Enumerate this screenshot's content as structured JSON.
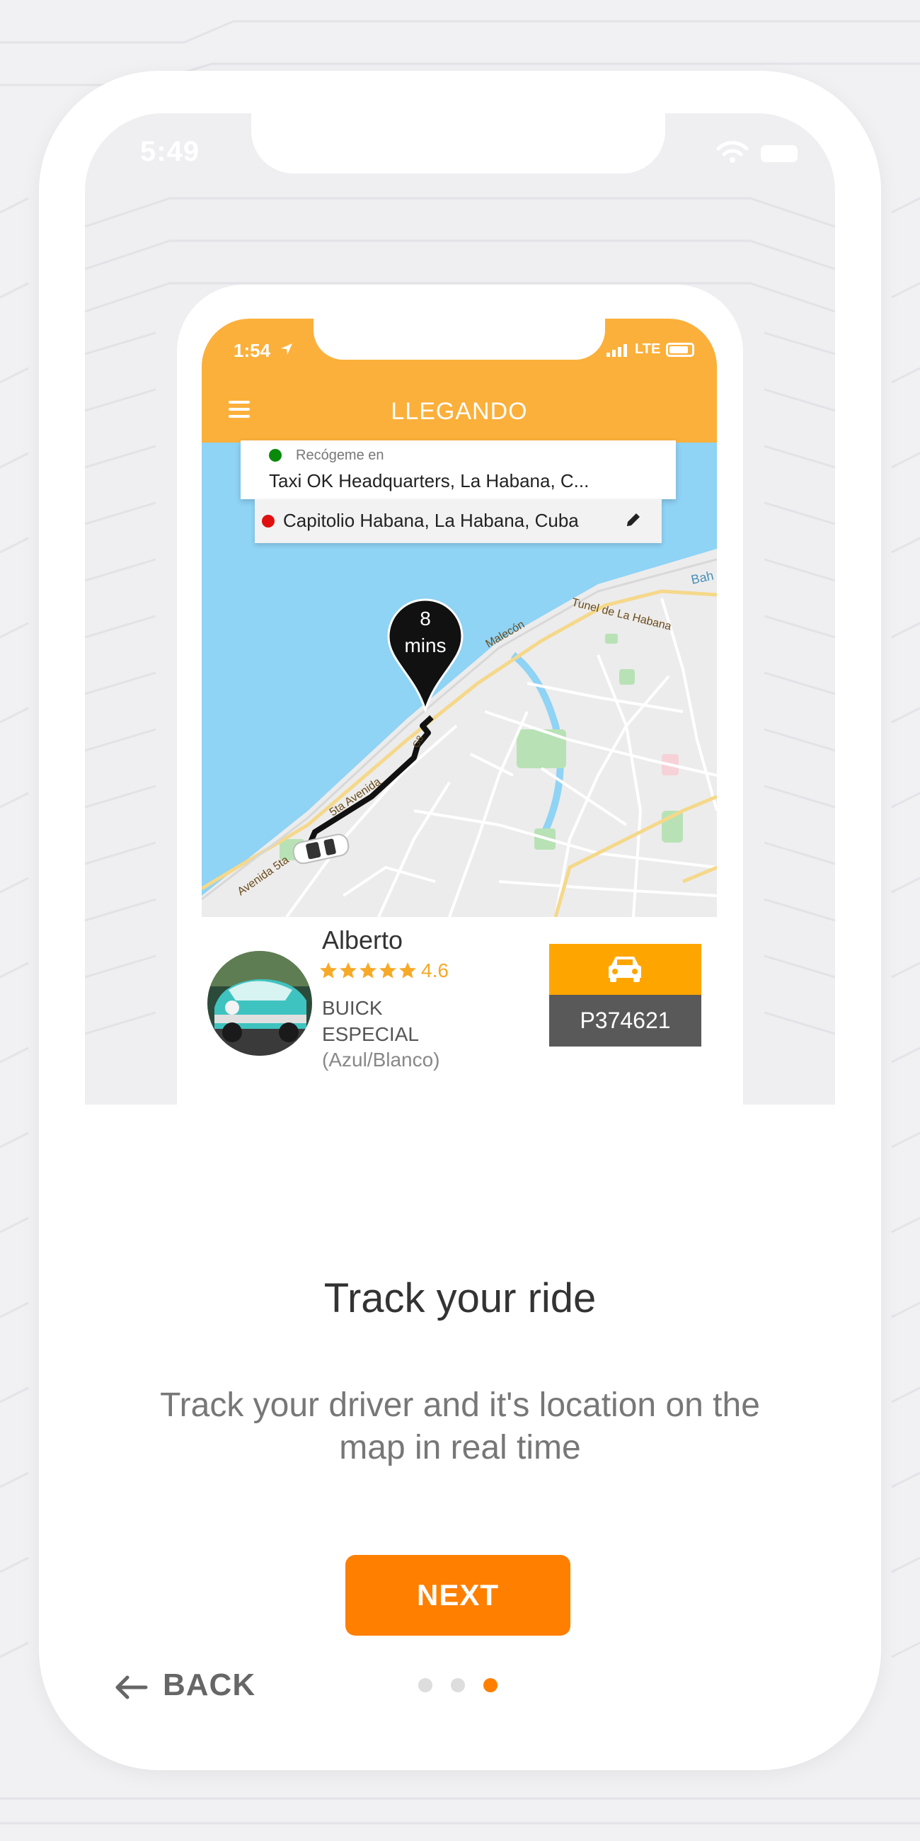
{
  "outer_status": {
    "time": "5:49"
  },
  "inner_status": {
    "time": "1:54",
    "network": "LTE"
  },
  "app_header": {
    "title": "LLEGANDO"
  },
  "pickup": {
    "hint": "Recógeme en",
    "value": "Taxi OK Headquarters,  La Habana,  C..."
  },
  "destination": {
    "value": "Capitolio Habana, La Habana, Cuba"
  },
  "eta": {
    "value": "8",
    "unit": "mins"
  },
  "map_labels": {
    "tunnel": "Tunel de La Habana",
    "malecon": "Malecón",
    "bahia": "Bah",
    "avenida5ta": "Avenida 5ta",
    "avenida5ta_2": "5ta Avenida",
    "route_shield": "G8"
  },
  "driver": {
    "name": "Alberto",
    "rating": "4.6",
    "stars": 5,
    "car_model": "BUICK ESPECIAL",
    "car_color": "(Azul/Blanco)",
    "plate": "P374621"
  },
  "onboarding": {
    "title": "Track your ride",
    "description": "Track your driver and it's location on the map in real time",
    "next_label": "NEXT",
    "back_label": "BACK",
    "page_count": 3,
    "current_page": 3
  },
  "colors": {
    "header": "#fbb03b",
    "accent": "#ff7f00",
    "pickup_dot": "#0a8a0a",
    "dest_dot": "#e01010",
    "water": "#8fd3f5",
    "land": "#ececec",
    "plate_bg": "#595959",
    "badge_bg": "#ffa500"
  },
  "icons": {
    "menu": "hamburger-icon",
    "edit": "pencil-icon",
    "taxi": "car-icon",
    "back": "arrow-left-icon",
    "location": "location-arrow-icon",
    "rating": "star-icon"
  }
}
